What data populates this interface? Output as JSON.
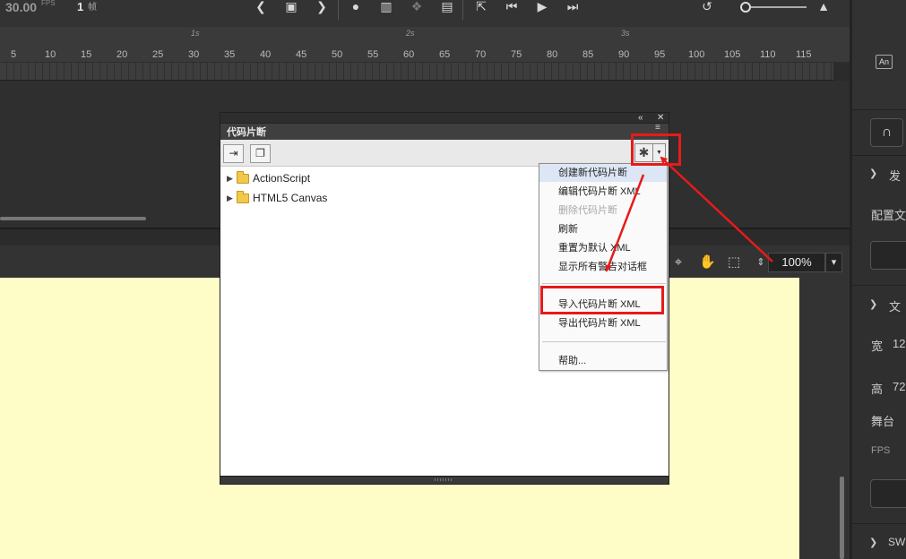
{
  "timeline": {
    "fps_value": "30.00",
    "fps_unit": "FPS",
    "frame_number": "1",
    "frame_unit": "帧",
    "second_markers": [
      "1s",
      "2s",
      "3s"
    ],
    "frame_ticks": [
      "5",
      "10",
      "15",
      "20",
      "25",
      "30",
      "35",
      "40",
      "45",
      "50",
      "55",
      "60",
      "65",
      "70",
      "75",
      "80",
      "85",
      "90",
      "95",
      "100",
      "105",
      "110",
      "115"
    ]
  },
  "stage": {
    "zoom_value": "100%"
  },
  "properties": {
    "an_icon": "An",
    "publish_label": "发",
    "profile_label": "配置文",
    "doc_label": "文",
    "width_label": "宽",
    "width_value": "12",
    "height_label": "高",
    "height_value": "72",
    "stage_label": "舞台",
    "fps_label": "FPS",
    "swf_label": "SW"
  },
  "code_snippets": {
    "title": "代码片断",
    "tree": [
      {
        "label": "ActionScript"
      },
      {
        "label": "HTML5 Canvas"
      }
    ]
  },
  "context_menu": {
    "items": [
      {
        "label": "创建新代码片断",
        "highlighted": true,
        "disabled": false
      },
      {
        "label": "编辑代码片断 XML",
        "highlighted": false,
        "disabled": false
      },
      {
        "label": "删除代码片断",
        "highlighted": false,
        "disabled": true
      },
      {
        "label": "刷新",
        "highlighted": false,
        "disabled": false
      },
      {
        "label": "重置为默认 XML",
        "highlighted": false,
        "disabled": false
      },
      {
        "label": "显示所有警告对话框",
        "highlighted": false,
        "disabled": false
      },
      {
        "label": "导入代码片断 XML",
        "highlighted": false,
        "disabled": false
      },
      {
        "label": "导出代码片断 XML",
        "highlighted": false,
        "disabled": false
      },
      {
        "label": "帮助...",
        "highlighted": false,
        "disabled": false
      }
    ]
  },
  "colors": {
    "annotation_red": "#e51b1b",
    "stage_fill": "#fefcc7",
    "menu_highlight": "#dce6f5"
  }
}
